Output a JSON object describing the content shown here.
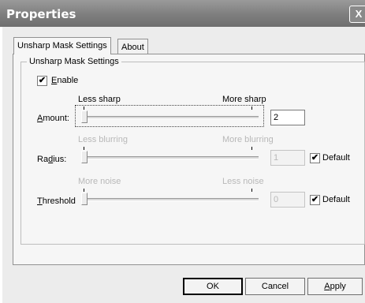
{
  "window": {
    "title": "Properties",
    "close_glyph": "X"
  },
  "tabs": [
    {
      "label": "Unsharp Mask Settings",
      "active": true
    },
    {
      "label": "About",
      "active": false
    }
  ],
  "group": {
    "title": "Unsharp Mask Settings"
  },
  "enable": {
    "label_pre": "",
    "label_mnemonic": "E",
    "label_post": "nable",
    "checked": true
  },
  "amount": {
    "label_pre": "",
    "label_mnemonic": "A",
    "label_post": "mount:",
    "left_hint": "Less sharp",
    "right_hint": "More sharp",
    "value": "2",
    "enabled": true
  },
  "radius": {
    "label_pre": "Ra",
    "label_mnemonic": "d",
    "label_post": "ius:",
    "left_hint": "Less blurring",
    "right_hint": "More blurring",
    "value": "1",
    "enabled": false,
    "default_label": "Default",
    "default_checked": true
  },
  "threshold": {
    "label_pre": "",
    "label_mnemonic": "T",
    "label_post": "hreshold",
    "left_hint": "More noise",
    "right_hint": "Less noise",
    "value": "0",
    "enabled": false,
    "default_label": "Default",
    "default_checked": true
  },
  "buttons": {
    "ok": "OK",
    "cancel": "Cancel",
    "apply_mnemonic": "A",
    "apply_rest": "pply"
  },
  "check_glyph": "✔"
}
